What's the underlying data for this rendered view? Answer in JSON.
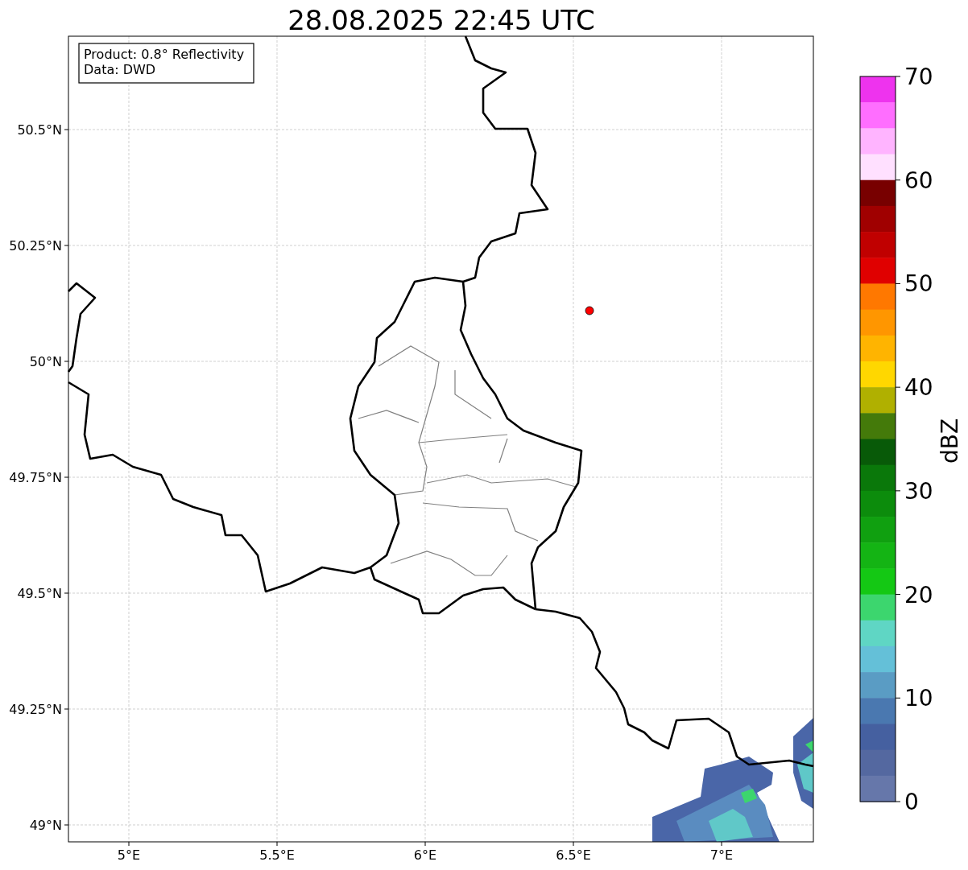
{
  "title": "28.08.2025 22:45 UTC",
  "info_box": {
    "lines": [
      "Product: 0.8° Reflectivity",
      "Data: DWD"
    ]
  },
  "map": {
    "lat_labels": [
      "50.5°N",
      "50.25°N",
      "50°N",
      "49.75°N",
      "49.5°N",
      "49.25°N",
      "49°N"
    ],
    "lon_labels": [
      "5°E",
      "5.5°E",
      "6°E",
      "6.5°E",
      "7°E"
    ]
  },
  "colorbar": {
    "label": "dBZ",
    "ticks": [
      "70",
      "60",
      "50",
      "40",
      "30",
      "20",
      "10",
      "0"
    ],
    "bins": [
      {
        "color": "#ee33ee"
      },
      {
        "color": "#ff6eff"
      },
      {
        "color": "#ffb4ff"
      },
      {
        "color": "#ffe0ff"
      },
      {
        "color": "#780000"
      },
      {
        "color": "#a00000"
      },
      {
        "color": "#c00000"
      },
      {
        "color": "#e00000"
      },
      {
        "color": "#ff7800"
      },
      {
        "color": "#ff9600"
      },
      {
        "color": "#ffb400"
      },
      {
        "color": "#ffd700"
      },
      {
        "color": "#b0b000"
      },
      {
        "color": "#447a0a"
      },
      {
        "color": "#085a08"
      },
      {
        "color": "#0a780a"
      },
      {
        "color": "#0c8c0c"
      },
      {
        "color": "#10a010"
      },
      {
        "color": "#14b414"
      },
      {
        "color": "#14c814"
      },
      {
        "color": "#3cd66e"
      },
      {
        "color": "#5fd6c4"
      },
      {
        "color": "#64c0d8"
      },
      {
        "color": "#5a9cc4"
      },
      {
        "color": "#4a78b0"
      },
      {
        "color": "#4560a0"
      },
      {
        "color": "#5468a0"
      },
      {
        "color": "#6677aa"
      }
    ]
  }
}
